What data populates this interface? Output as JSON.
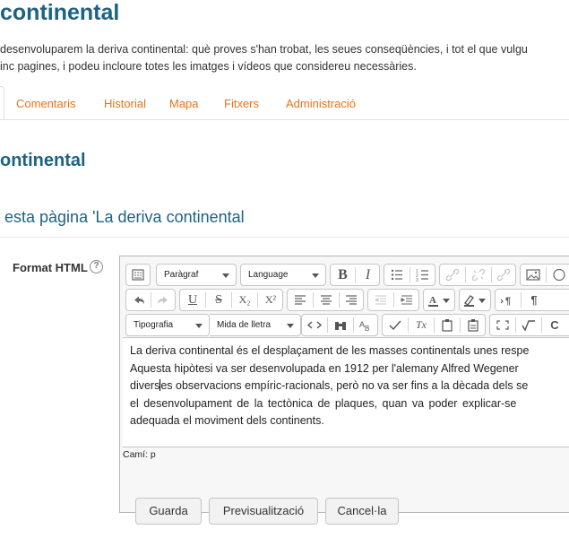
{
  "page": {
    "title": "continental",
    "intro_line1": "desenvoluparem la deriva continental: què proves s'han trobat, les seues conseqüències, i tot el que vulgu",
    "intro_line2": "inc pagines, i podeu incloure totes les imatges i vídeos que considereu necessàries."
  },
  "tabs": [
    "Comentaris",
    "Historial",
    "Mapa",
    "Fitxers",
    "Administració"
  ],
  "section_title": "ontinental",
  "edit_heading": "esta pàgina 'La deriva continental",
  "format": {
    "label": "Format HTML",
    "help_icon": "?"
  },
  "editor": {
    "paragraph_select": "Paràgraf",
    "language_select": "Language",
    "font_select": "Tipografia",
    "size_select": "Mida de lletra",
    "buttons": {
      "bold": "B",
      "italic": "I",
      "underline": "U",
      "strike": "S",
      "subscript": "X₂",
      "superscript": "X²",
      "pilcrow": "¶",
      "c": "C",
      "tx": "Tx"
    },
    "content_line1": "La deriva continental és el desplaçament de les masses continentals unes respe",
    "content_line2": "Aquesta hipòtesi va ser desenvolupada en 1912 per l'alemany Alfred Wegener",
    "content_line3a": "divers",
    "content_line3b": "es observacions empíric-racionals, però no va ser fins a la dècada dels se",
    "content_line4": "el desenvolupament de la tectònica de plaques, quan va poder explicar-se",
    "content_line5": "adequada el moviment dels continents.",
    "path": "Camí: p"
  },
  "actions": {
    "save": "Guarda",
    "preview": "Previsualització",
    "cancel": "Cancel·la"
  },
  "colors": {
    "heading": "#1c6383",
    "tab_link": "#e8731b"
  }
}
